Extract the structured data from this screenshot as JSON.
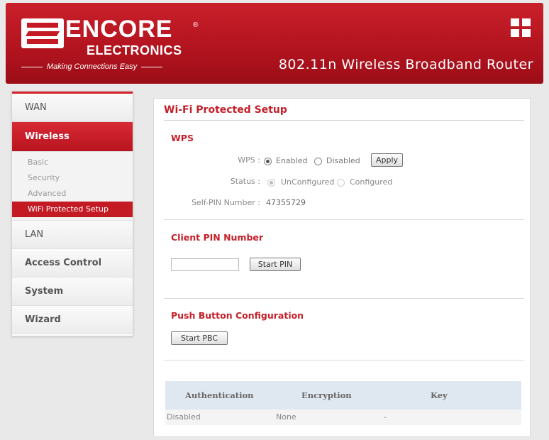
{
  "header": {
    "brand_main": "ENCORE",
    "brand_reg": "®",
    "brand_sub": "ELECTRONICS",
    "tagline": "Making Connections Easy",
    "product_title": "802.11n Wireless Broadband Router",
    "grid_icon": "grid-icon"
  },
  "sidebar": {
    "items": [
      {
        "label": "WAN"
      },
      {
        "label": "Wireless"
      },
      {
        "label": "LAN"
      },
      {
        "label": "Access Control"
      },
      {
        "label": "System"
      },
      {
        "label": "Wizard"
      }
    ],
    "wireless_sub": [
      {
        "label": "Basic"
      },
      {
        "label": "Security"
      },
      {
        "label": "Advanced"
      },
      {
        "label": "WiFi Protected Setup"
      }
    ]
  },
  "main": {
    "title": "Wi-Fi Protected Setup",
    "wps": {
      "section_title": "WPS",
      "wps_label": "WPS :",
      "enabled_label": "Enabled",
      "disabled_label": "Disabled",
      "wps_value": "Enabled",
      "apply_label": "Apply",
      "status_label": "Status :",
      "unconfigured_label": "UnConfigured",
      "configured_label": "Configured",
      "status_value": "UnConfigured",
      "self_pin_label": "Self-PIN Number :",
      "self_pin_value": "47355729"
    },
    "client_pin": {
      "section_title": "Client PIN Number",
      "input_value": "",
      "start_pin_label": "Start PIN"
    },
    "pbc": {
      "section_title": "Push Button Configuration",
      "start_pbc_label": "Start PBC"
    },
    "table": {
      "headers": [
        "Authentication",
        "Encryption",
        "Key"
      ],
      "rows": [
        [
          "Disabled",
          "None",
          "-"
        ]
      ]
    }
  },
  "colors": {
    "brand_red": "#c4202a",
    "header_red": "#b3141f",
    "table_header_bg": "#dfe7f0"
  }
}
